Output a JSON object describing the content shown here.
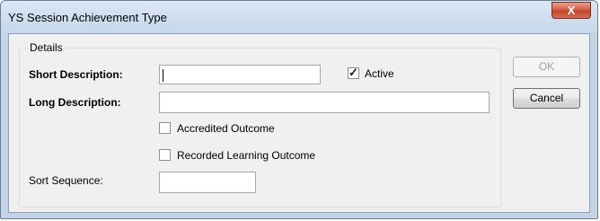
{
  "window": {
    "title": "YS Session Achievement Type",
    "close_glyph": "X"
  },
  "details": {
    "group_label": "Details",
    "short_description_label": "Short Description:",
    "short_description_value": "",
    "active_label": "Active",
    "active_checked": true,
    "long_description_label": "Long Description:",
    "long_description_value": "",
    "accredited_outcome_label": "Accredited Outcome",
    "accredited_outcome_checked": false,
    "recorded_learning_label": "Recorded Learning Outcome",
    "recorded_learning_checked": false,
    "sort_sequence_label": "Sort Sequence:",
    "sort_sequence_value": ""
  },
  "buttons": {
    "ok_label": "OK",
    "cancel_label": "Cancel"
  },
  "icons": {
    "close": "close-icon",
    "checkmark": "checkmark-icon"
  },
  "colors": {
    "frame": "#c3d4e7",
    "client": "#f0f0f0",
    "close_button": "#c9472b"
  }
}
